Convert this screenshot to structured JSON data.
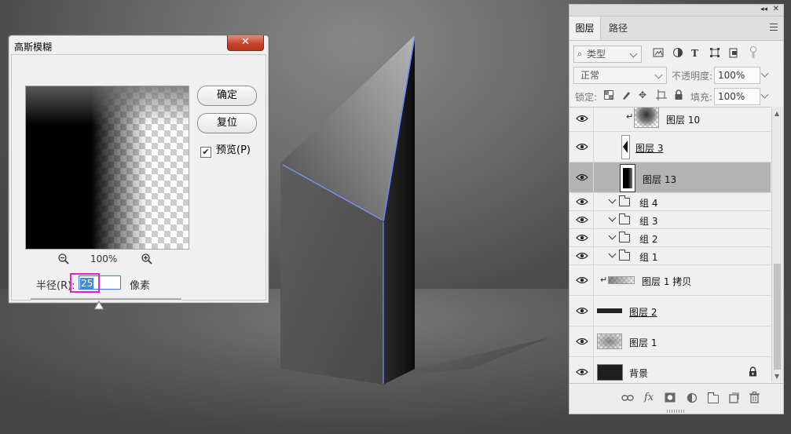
{
  "dialog": {
    "title": "高斯模糊",
    "close_glyph": "✕",
    "ok_label": "确定",
    "reset_label": "复位",
    "preview_label": "预览(P)",
    "preview_checked": true,
    "zoom_value": "100%",
    "radius_label": "半径(R):",
    "radius_value": "25",
    "radius_unit": "像素"
  },
  "layers_panel": {
    "tabs": [
      {
        "label": "图层"
      },
      {
        "label": "路径"
      }
    ],
    "filter_kind": "类型",
    "blend_mode": "正常",
    "opacity_label": "不透明度:",
    "opacity_value": "100%",
    "lock_label": "锁定:",
    "fill_label": "填充:",
    "fill_value": "100%",
    "layers": [
      {
        "name": "图层 10",
        "type": "clipped",
        "visible": true,
        "selected": false
      },
      {
        "name": "图层 3",
        "type": "clipped",
        "visible": true,
        "selected": false
      },
      {
        "name": "图层 13",
        "type": "layer",
        "visible": true,
        "selected": true
      },
      {
        "name": "组 4",
        "type": "group",
        "visible": true,
        "selected": false
      },
      {
        "name": "组 3",
        "type": "group",
        "visible": true,
        "selected": false
      },
      {
        "name": "组 2",
        "type": "group",
        "visible": true,
        "selected": false
      },
      {
        "name": "组 1",
        "type": "group",
        "visible": true,
        "selected": false
      },
      {
        "name": "图层 1 拷贝",
        "type": "clipped",
        "visible": true,
        "selected": false
      },
      {
        "name": "图层 2",
        "type": "layer",
        "visible": true,
        "selected": false
      },
      {
        "name": "图层 1",
        "type": "layer",
        "visible": true,
        "selected": false
      },
      {
        "name": "背景",
        "type": "background",
        "visible": true,
        "selected": false,
        "locked": true
      }
    ],
    "bottom_icons": [
      "link-icon",
      "fx-icon",
      "mask-icon",
      "adjustment-icon",
      "folder-icon",
      "new-layer-icon",
      "trash-icon"
    ]
  },
  "colors": {
    "highlight_box": "#e21fd7",
    "selected_row": "#b3b3b3",
    "edge_glow": "#6f86ff"
  }
}
